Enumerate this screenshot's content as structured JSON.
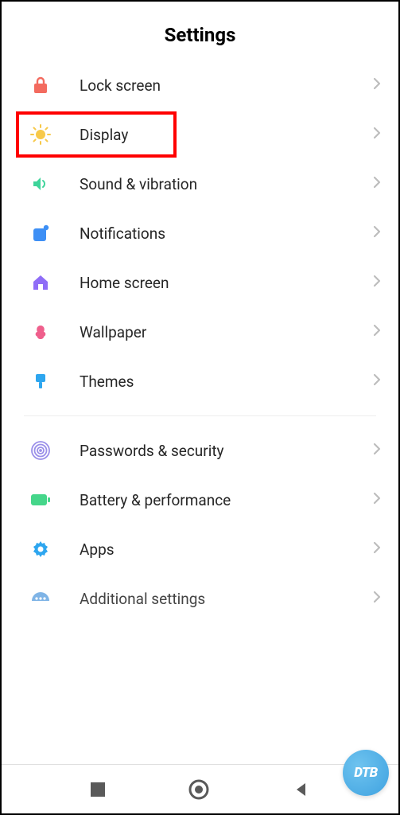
{
  "header": {
    "title": "Settings"
  },
  "groups": [
    {
      "items": [
        {
          "id": "lock-screen",
          "label": "Lock screen",
          "icon": "lock",
          "color": "#f36b5f",
          "highlighted": false
        },
        {
          "id": "display",
          "label": "Display",
          "icon": "sun",
          "color": "#f7c94a",
          "highlighted": true
        },
        {
          "id": "sound",
          "label": "Sound & vibration",
          "icon": "speaker",
          "color": "#3ed49a",
          "highlighted": false
        },
        {
          "id": "notifications",
          "label": "Notifications",
          "icon": "notif",
          "color": "#3d8ff5",
          "highlighted": false
        },
        {
          "id": "home-screen",
          "label": "Home screen",
          "icon": "home",
          "color": "#8f6df7",
          "highlighted": false
        },
        {
          "id": "wallpaper",
          "label": "Wallpaper",
          "icon": "flower",
          "color": "#ef5f8c",
          "highlighted": false
        },
        {
          "id": "themes",
          "label": "Themes",
          "icon": "brush",
          "color": "#2ea6ef",
          "highlighted": false
        }
      ]
    },
    {
      "items": [
        {
          "id": "passwords",
          "label": "Passwords & security",
          "icon": "fingerprint",
          "color": "#9a8fe9",
          "highlighted": false
        },
        {
          "id": "battery",
          "label": "Battery & performance",
          "icon": "battery",
          "color": "#45d68a",
          "highlighted": false
        },
        {
          "id": "apps",
          "label": "Apps",
          "icon": "gear",
          "color": "#2ea6ef",
          "highlighted": false
        },
        {
          "id": "additional",
          "label": "Additional settings",
          "icon": "dots",
          "color": "#7fb4e6",
          "highlighted": false,
          "cutoff": true
        }
      ]
    }
  ],
  "badge": {
    "text": "DTB"
  }
}
